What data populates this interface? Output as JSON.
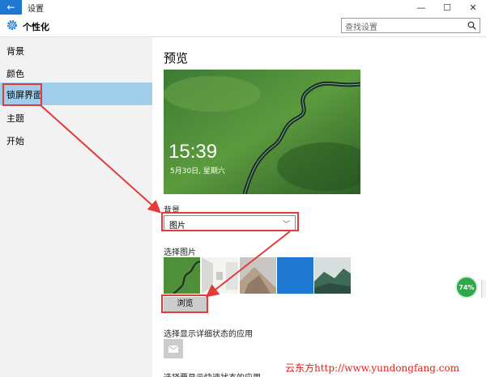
{
  "window": {
    "title": "设置",
    "back_icon": "←",
    "minimize_icon": "—",
    "maximize_icon": "☐",
    "close_icon": "✕"
  },
  "header": {
    "title": "个性化",
    "search_placeholder": "查找设置"
  },
  "sidebar": {
    "items": [
      {
        "label": "背景"
      },
      {
        "label": "颜色"
      },
      {
        "label": "锁屏界面"
      },
      {
        "label": "主题"
      },
      {
        "label": "开始"
      }
    ],
    "selected_index": 2
  },
  "content": {
    "preview_heading": "预览",
    "lock_time": "15:39",
    "lock_date": "5月30日, 星期六",
    "background_label": "背景",
    "background_value": "图片",
    "choose_picture_label": "选择图片",
    "browse_label": "浏览",
    "detailed_status_label": "选择显示详细状态的应用",
    "quick_status_label": "选择要显示快速状态的应用"
  },
  "overlay": {
    "battery_percent": "74%",
    "watermark": "云东方http://www.yundongfang.com"
  },
  "colors": {
    "accent": "#1e78d2",
    "sidebar_bg": "#f2f2f2",
    "selected_bg": "#a0cdea",
    "annotation_red": "#e33a3a"
  }
}
